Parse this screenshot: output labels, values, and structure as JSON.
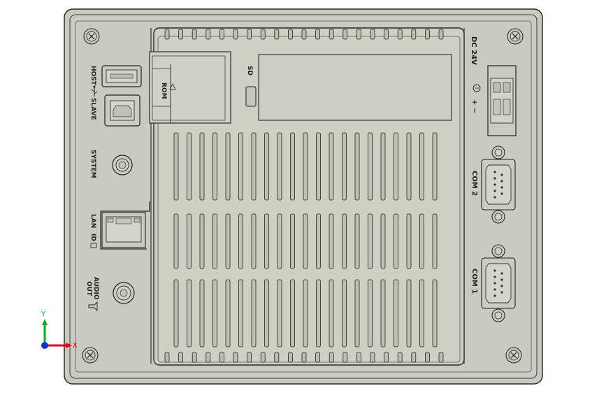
{
  "labels": {
    "host": "HOST",
    "slave": "SLAVE",
    "system": "SYSTEM",
    "lan": "LAN",
    "lan_id": "ID",
    "audio": "AUDIO",
    "audio_out": "OUT",
    "sd": "SD",
    "rom": "ROM",
    "dc": "DC 24V",
    "plus_minus": "+ −",
    "com2": "COM 2",
    "com1": "COM 1"
  },
  "axes": {
    "x": "X",
    "y": "Y"
  },
  "colors": {
    "panel": "#c9c9bf",
    "outline": "#2a2a2a",
    "inner_panel": "#cfcfc4",
    "axis_x": "#e0001c",
    "axis_y": "#00b020",
    "axis_z": "#1030e0"
  },
  "icons": [
    "screw-icon",
    "usb-a-port",
    "usb-b-port",
    "rj45-port",
    "db9-port",
    "audio-jack",
    "power-terminal",
    "ground-icon",
    "speaker-icon",
    "coordinate-triad-icon"
  ]
}
